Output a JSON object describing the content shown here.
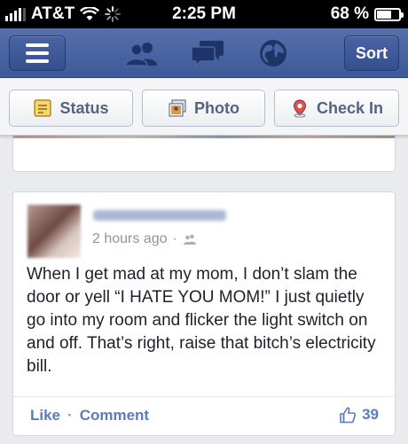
{
  "status_bar": {
    "carrier": "AT&T",
    "time": "2:25 PM",
    "battery": "68 %",
    "battery_level": 0.68
  },
  "nav": {
    "sort_label": "Sort",
    "icons": [
      "menu-icon",
      "friends-icon",
      "messages-icon",
      "globe-icon"
    ]
  },
  "publisher": {
    "status_label": "Status",
    "photo_label": "Photo",
    "checkin_label": "Check In"
  },
  "post": {
    "time": "2 hours ago",
    "separator": "·",
    "text": "When I get mad at my mom, I don’t slam the door or yell “I HATE YOU MOM!” I just quietly go into my room and flicker the light switch on and off. That’s right, raise that bitch’s electricity bill.",
    "like_label": "Like",
    "comment_label": "Comment",
    "like_count": "39"
  },
  "colors": {
    "nav_blue": "#3d5998",
    "link_blue": "#5b7bbd",
    "text": "#1d2129"
  }
}
